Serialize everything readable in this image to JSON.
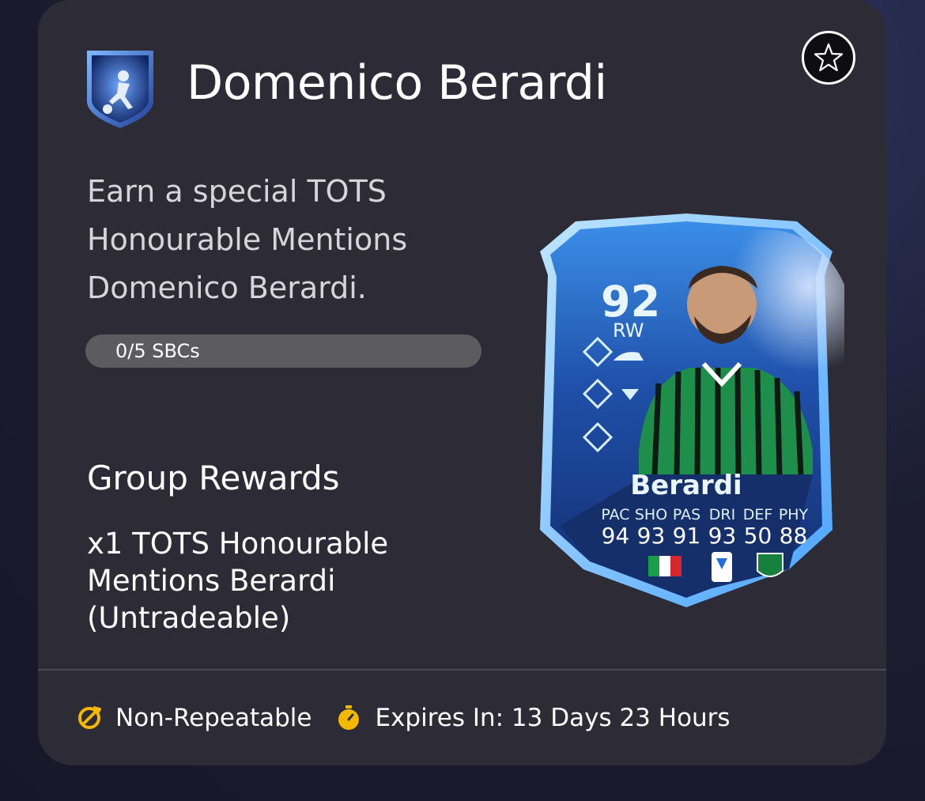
{
  "header": {
    "title": "Domenico Berardi"
  },
  "description": "Earn a special TOTS Honourable Mentions Domenico Berardi.",
  "progress": {
    "label": "0/5 SBCs",
    "fraction": 0.0
  },
  "group_rewards": {
    "title": "Group Rewards",
    "items": [
      "x1 TOTS Honourable Mentions Berardi (Untradeable)"
    ]
  },
  "player_card": {
    "rating": "92",
    "position": "RW",
    "name": "Berardi",
    "stats": [
      {
        "label": "PAC",
        "value": "94"
      },
      {
        "label": "SHO",
        "value": "93"
      },
      {
        "label": "PAS",
        "value": "91"
      },
      {
        "label": "DRI",
        "value": "93"
      },
      {
        "label": "DEF",
        "value": "50"
      },
      {
        "label": "PHY",
        "value": "88"
      }
    ]
  },
  "footer": {
    "repeat_label": "Non-Repeatable",
    "expiry_label": "Expires In: 13 Days 23 Hours"
  },
  "colors": {
    "card_bg": "#2c2b36",
    "accent_yellow": "#f5b800",
    "progress_bg": "#5c5c5f",
    "card_blue": "#2a7bd8"
  }
}
